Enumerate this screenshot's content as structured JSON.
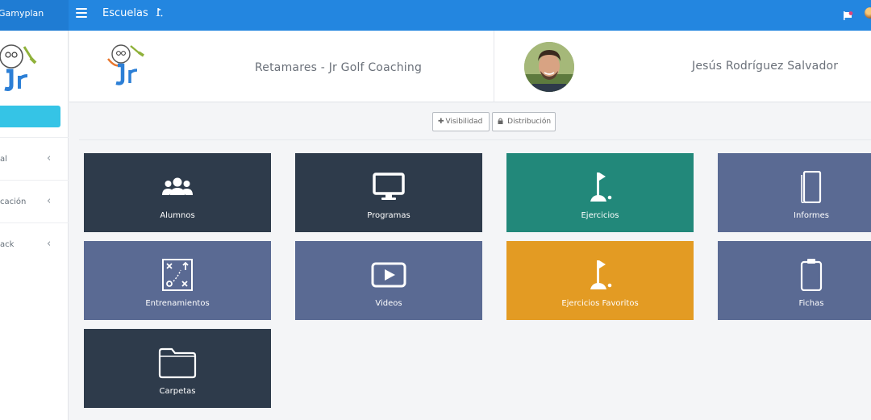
{
  "topbar": {
    "brand": "Gamyplan",
    "breadcrumb": "Escuelas"
  },
  "sidebar": {
    "items": [
      {
        "label": "al"
      },
      {
        "label": "cación"
      },
      {
        "label": "ack"
      }
    ]
  },
  "header": {
    "school_name": "Retamares - Jr Golf Coaching",
    "coach_name": "Jesús Rodríguez Salvador"
  },
  "actions": {
    "visibility_label": "Visibilidad",
    "distribution_label": "Distribución"
  },
  "tiles": [
    {
      "label": "Alumnos",
      "icon": "users-icon",
      "color": "#2e3b4b"
    },
    {
      "label": "Programas",
      "icon": "monitor-icon",
      "color": "#2e3b4b"
    },
    {
      "label": "Ejercicios",
      "icon": "golf-flag-icon",
      "color": "#22887a"
    },
    {
      "label": "Informes",
      "icon": "tablet-icon",
      "color": "#5a6a93"
    },
    {
      "label": "Entrenamientos",
      "icon": "tactics-board-icon",
      "color": "#5a6a93"
    },
    {
      "label": "Videos",
      "icon": "play-icon",
      "color": "#5a6a93"
    },
    {
      "label": "Ejercicios Favoritos",
      "icon": "golf-flag-icon",
      "color": "#e39b23"
    },
    {
      "label": "Fichas",
      "icon": "clipboard-icon",
      "color": "#5a6a93"
    },
    {
      "label": "Carpetas",
      "icon": "folder-icon",
      "color": "#2e3b4b"
    }
  ]
}
